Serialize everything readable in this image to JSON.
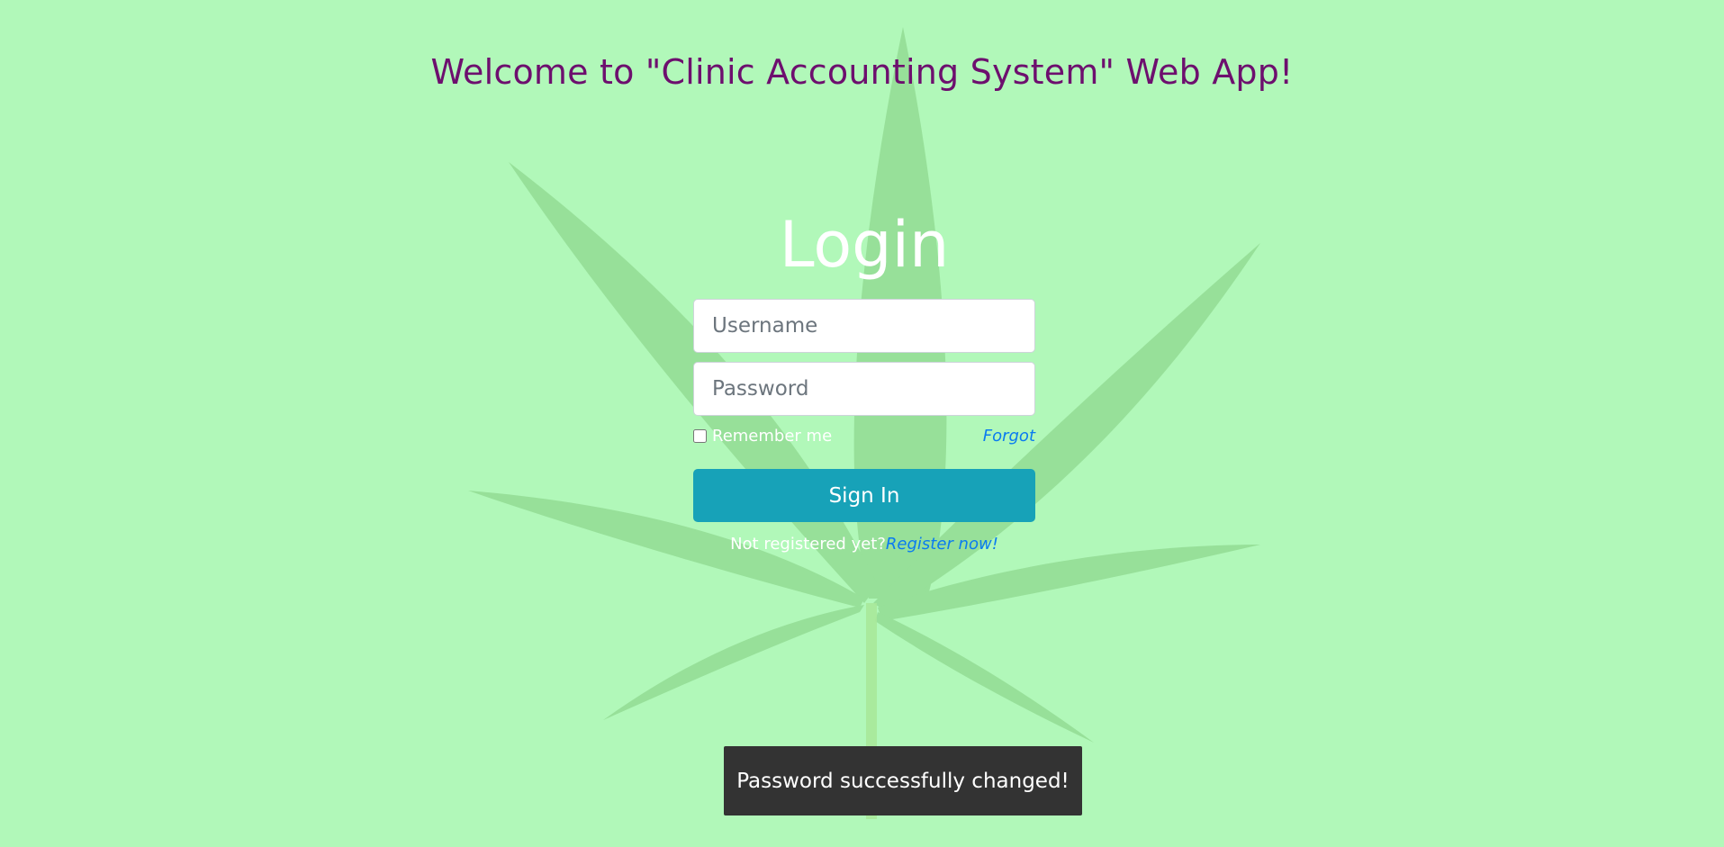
{
  "header": {
    "welcome_text": "Welcome to \"Clinic Accounting System\" Web App!"
  },
  "login": {
    "title": "Login",
    "username_placeholder": "Username",
    "password_placeholder": "Password",
    "remember_label": "Remember me",
    "remember_checked": false,
    "forgot_label": "Forgot",
    "signin_label": "Sign In",
    "register_prompt": "Not registered yet?",
    "register_link": "Register now!"
  },
  "toast": {
    "message": "Password successfully changed!"
  },
  "background": {
    "image": "cannabis-leaf-icon",
    "page_color": "#b1f8b9",
    "leaf_color": "#8fd88f"
  },
  "colors": {
    "welcome": "#6d0f6e",
    "link": "#0a7bf0",
    "signin_button": "#17a2b8",
    "toast_bg": "#333333"
  }
}
